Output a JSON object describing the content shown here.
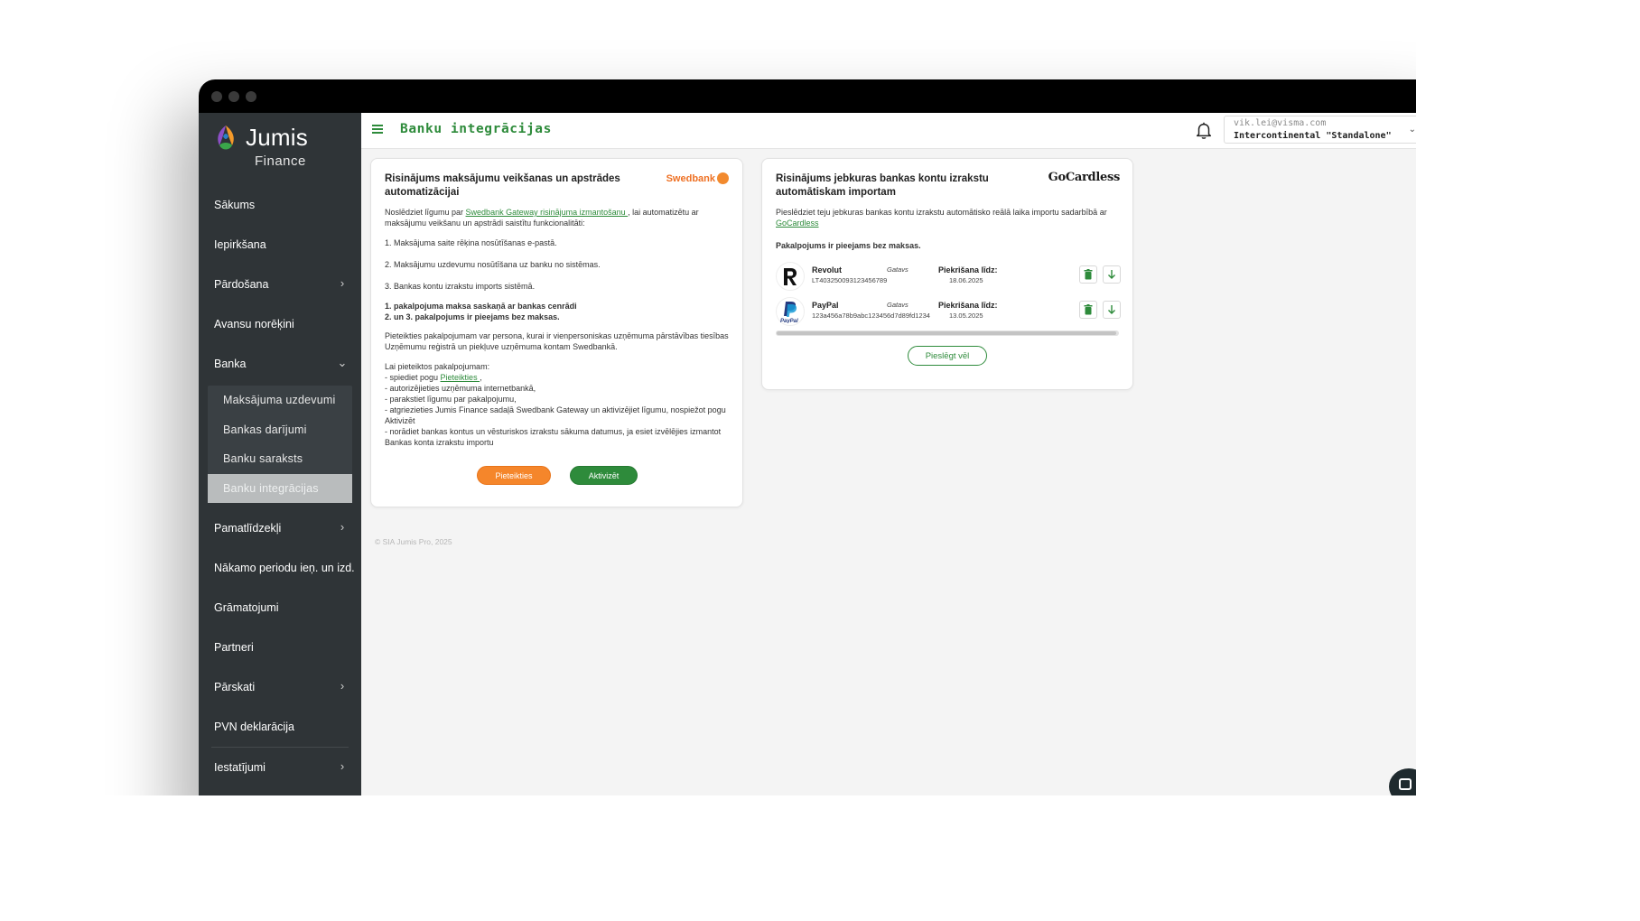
{
  "app": {
    "logo_name": "Jumis",
    "logo_sub": "Finance"
  },
  "header": {
    "title": "Banku integrācijas",
    "user_email": "vik.lei@visma.com",
    "user_company": "Intercontinental \"Standalone\""
  },
  "sidebar": {
    "items": [
      {
        "label": "Sākums"
      },
      {
        "label": "Iepirkšana"
      },
      {
        "label": "Pārdošana"
      },
      {
        "label": "Avansu norēķini"
      },
      {
        "label": "Banka"
      },
      {
        "label": "Pamatlīdzekļi"
      },
      {
        "label": "Nākamo periodu ieņ. un izd."
      },
      {
        "label": "Grāmatojumi"
      },
      {
        "label": "Partneri"
      },
      {
        "label": "Pārskati"
      },
      {
        "label": "PVN deklarācija"
      },
      {
        "label": "Iestatījumi"
      }
    ],
    "banka_sub": [
      {
        "label": "Maksājuma uzdevumi"
      },
      {
        "label": "Bankas darījumi"
      },
      {
        "label": "Banku saraksts"
      },
      {
        "label": "Banku integrācijas"
      }
    ]
  },
  "swedbank_card": {
    "title": "Risinājums maksājumu veikšanas un apstrādes automatizācijai",
    "brand": "Swedbank",
    "intro_before": "Noslēdziet līgumu par ",
    "intro_link": "Swedbank Gateway risinājuma izmantošanu ",
    "intro_after": ", lai automatizētu ar maksājumu veikšanu un apstrādi saistītu funkcionalitāti:",
    "item1": "1. Maksājuma saite rēķina nosūtīšanas e-pastā.",
    "item2": "2. Maksājumu uzdevumu nosūtīšana uz banku no sistēmas.",
    "item3": "3. Bankas kontu izrakstu imports sistēmā.",
    "bold1": "1. pakalpojuma maksa saskaņā ar bankas cenrādi",
    "bold2": "2. un 3. pakalpojums ir pieejams bez maksas.",
    "eligibility": "Pieteikties pakalpojumam var persona, kurai ir vienpersoniskas uzņēmuma pārstāvības tiesības Uzņēmumu reģistrā un piekļuve uzņēmuma kontam Swedbankā.",
    "steps_title": "Lai pieteiktos pakalpojumam:",
    "step1_before": "- spiediet pogu ",
    "step1_link": "Pieteikties ",
    "step1_after": ",",
    "step2": "- autorizējieties uzņēmuma internetbankā,",
    "step3": "- parakstiet līgumu par pakalpojumu,",
    "step4": "- atgriezieties Jumis Finance sadaļā Swedbank Gateway un aktivizējiet līgumu, nospiežot pogu Aktivizēt",
    "step5": "- norādiet bankas kontus un vēsturiskos izrakstu sākuma datumus, ja esiet izvēlējies izmantot Bankas konta izrakstu importu",
    "apply_button": "Pieteikties",
    "activate_button": "Aktivizēt"
  },
  "gocardless_card": {
    "title": "Risinājums jebkuras bankas kontu izrakstu automātiskam importam",
    "brand": "GoCardless",
    "intro_before": "Pieslēdziet teju jebkuras bankas kontu izrakstu automātisko reālā laika importu sadarbībā ar ",
    "intro_link": "GoCardless",
    "free_note": "Pakalpojums ir pieejams bez maksas.",
    "accounts": [
      {
        "name": "Revolut",
        "iban": "LT403250093123456789",
        "status": "Gatavs",
        "consent_label": "Piekrišana līdz:",
        "consent_date": "18.06.2025"
      },
      {
        "name": "PayPal",
        "iban": "123a456a78b9abc123456d7d89fd1234",
        "status": "Gatavs",
        "consent_label": "Piekrišana līdz:",
        "consent_date": "13.05.2025"
      }
    ],
    "connect_more": "Pieslēgt vēl"
  },
  "footer": {
    "copyright": "© SIA Jumis Pro, 2025"
  },
  "colors": {
    "brand_green": "#2e8b3b",
    "sidebar_bg": "#2f3437",
    "swedbank_orange": "#f5862b"
  }
}
